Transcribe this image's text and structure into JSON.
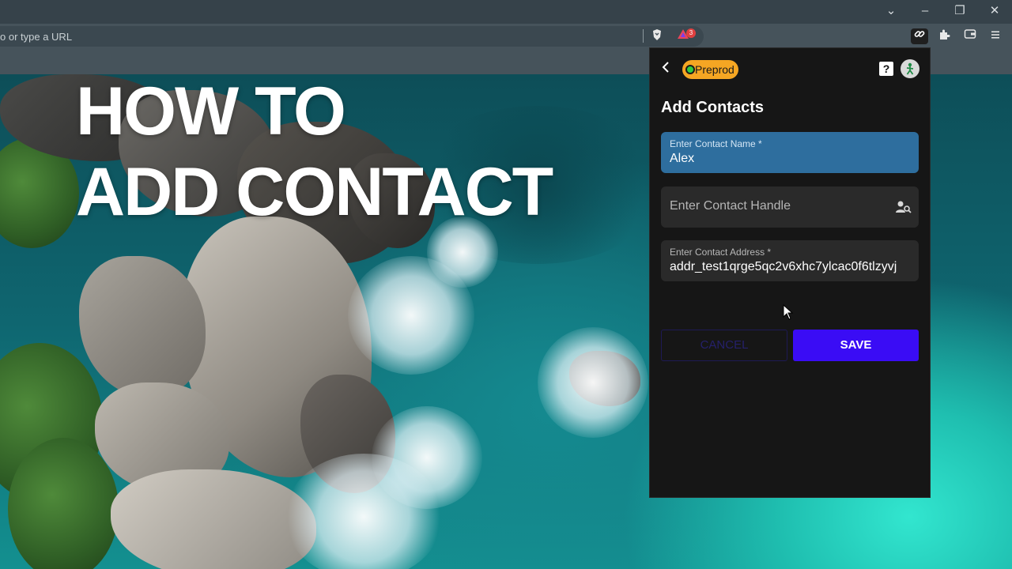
{
  "video_overlay": {
    "line1": "HOW TO",
    "line2": "ADD CONTACT"
  },
  "browser": {
    "window_controls": {
      "collapse": "⌄",
      "minimize": "–",
      "restore": "❐",
      "close": "✕"
    },
    "omnibox_placeholder": "o or type a URL",
    "extension_badge_count": "3",
    "toolbar_icons": [
      "brave-shield-icon",
      "brave-rewards-icon",
      "link-extension-icon",
      "puzzle-extensions-icon",
      "wallet-icon",
      "menu-icon"
    ]
  },
  "popup": {
    "network_badge": "Preprod",
    "network_colors": {
      "badge": "#f5a623",
      "dot": "#2ecc40"
    },
    "title": "Add Contacts",
    "fields": {
      "name": {
        "label": "Enter Contact Name *",
        "value": "Alex"
      },
      "handle": {
        "placeholder": "Enter Contact Handle"
      },
      "address": {
        "label": "Enter Contact Address *",
        "value": "addr_test1qrge5qc2v6xhc7ylcac0f6tlzyvj"
      }
    },
    "buttons": {
      "cancel": "CANCEL",
      "save": "SAVE"
    },
    "accent_color": "#3a0cf5"
  }
}
